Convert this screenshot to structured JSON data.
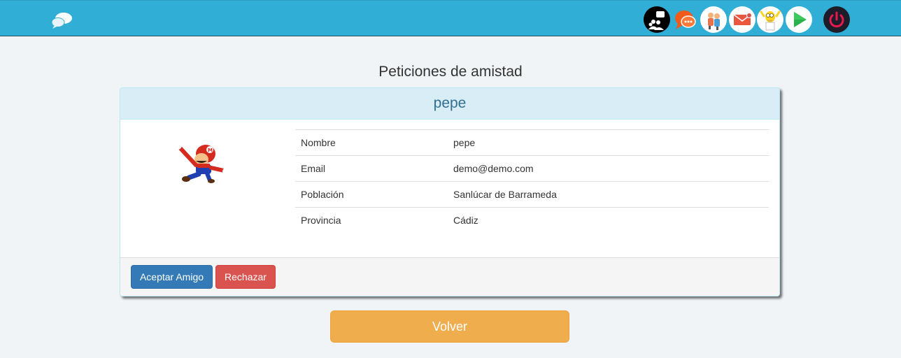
{
  "navbar": {
    "brand_icon": "chat-bubbles-icon",
    "icons": [
      {
        "name": "group-chat-icon",
        "color": "#000000"
      },
      {
        "name": "messages-icon",
        "color": "#f05a1a"
      },
      {
        "name": "friends-icon",
        "color": "#ffffff"
      },
      {
        "name": "mail-icon",
        "color": "#ffffff"
      },
      {
        "name": "homer-avatar-icon",
        "color": "#ffffff"
      },
      {
        "name": "play-icon",
        "color": "#ffffff"
      },
      {
        "name": "power-icon",
        "color": "#e8194f"
      }
    ]
  },
  "page": {
    "title": "Peticiones de amistad"
  },
  "request": {
    "heading": "pepe",
    "avatar": "mario-avatar",
    "fields": [
      {
        "label": "Nombre",
        "value": "pepe"
      },
      {
        "label": "Email",
        "value": "demo@demo.com"
      },
      {
        "label": "Población",
        "value": "Sanlúcar de Barrameda"
      },
      {
        "label": "Provincia",
        "value": "Cádiz"
      }
    ],
    "accept_label": "Aceptar Amigo",
    "reject_label": "Rechazar"
  },
  "back_label": "Volver",
  "colors": {
    "navbar": "#30aed6",
    "accept": "#337ab7",
    "reject": "#d9534f",
    "back": "#f0ad4e"
  }
}
